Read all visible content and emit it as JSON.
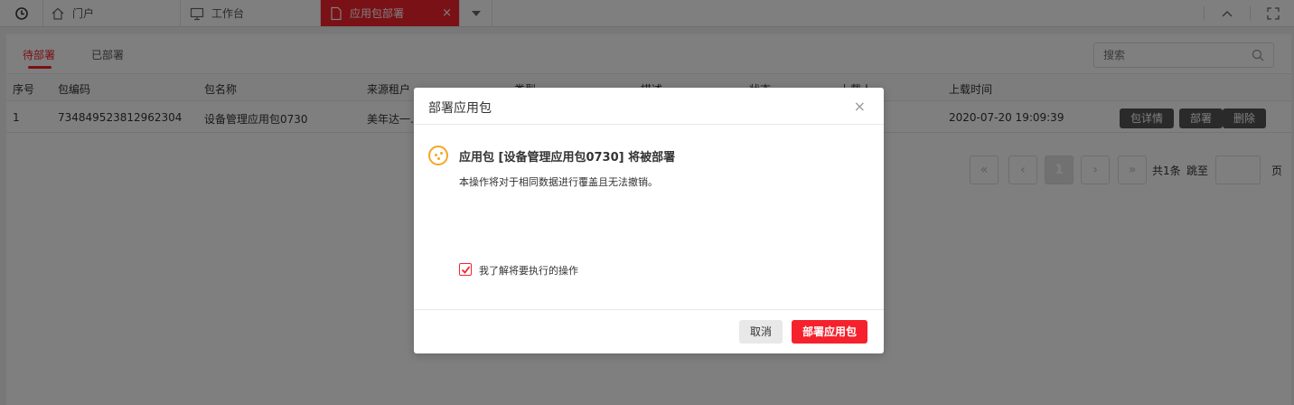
{
  "topbar": {
    "tabs": [
      {
        "label": "门户",
        "icon": "home-icon"
      },
      {
        "label": "工作台",
        "icon": "monitor-icon"
      },
      {
        "label": "应用包部署",
        "icon": "file-icon",
        "active": true,
        "close": "×"
      }
    ],
    "accent": "#f5222d"
  },
  "page": {
    "subtabs": [
      "待部署",
      "已部署"
    ],
    "search_placeholder": "搜索",
    "columns": [
      "序号",
      "包编码",
      "包名称",
      "来源租户",
      "类型",
      "描述",
      "状态",
      "上载人",
      "上载时间"
    ],
    "row": {
      "index": "1",
      "code": "734849523812962304",
      "name": "设备管理应用包0730",
      "tenant": "美年达一...",
      "time": "2020-07-20 19:09:39"
    },
    "row_actions": [
      "包详情",
      "部署",
      "删除"
    ],
    "pager": {
      "first": "«",
      "prev": "‹",
      "current": "1",
      "next": "›",
      "last": "»",
      "total": "共1条",
      "jump": "跳至",
      "page_unit": "页"
    }
  },
  "modal": {
    "title": "部署应用包",
    "close": "×",
    "message": "应用包 [设备管理应用包0730] 将被部署",
    "sub_message": "本操作将对于相同数据进行覆盖且无法撤销。",
    "checkbox_label": "我了解将要执行的操作",
    "checkbox_checked": true,
    "cancel": "取消",
    "confirm": "部署应用包"
  }
}
